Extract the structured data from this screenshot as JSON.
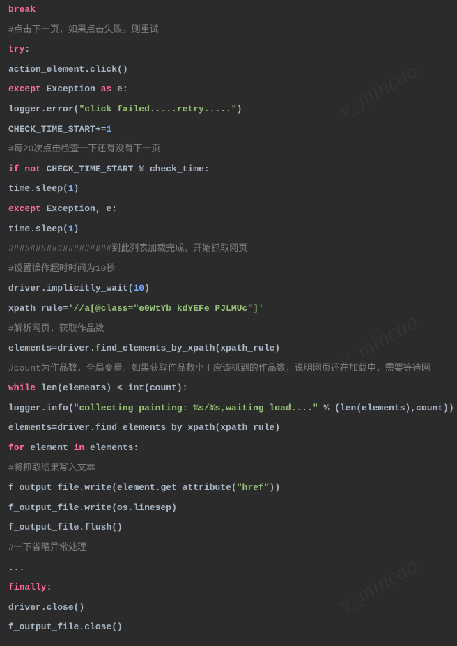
{
  "watermark": "v_mincao",
  "lines": [
    [
      {
        "t": "break",
        "c": "break"
      }
    ],
    [
      {
        "t": "#点击下一页，如果点击失败，则重试",
        "c": "comment"
      }
    ],
    [
      {
        "t": "try",
        "c": "try"
      },
      {
        "t": ":",
        "c": "punc"
      }
    ],
    [
      {
        "t": "action_element",
        "c": "ident"
      },
      {
        "t": ".",
        "c": "dot"
      },
      {
        "t": "click",
        "c": "ident"
      },
      {
        "t": "()",
        "c": "punc"
      }
    ],
    [
      {
        "t": "except",
        "c": "except"
      },
      {
        "t": " Exception ",
        "c": "ident"
      },
      {
        "t": "as",
        "c": "as"
      },
      {
        "t": " e:",
        "c": "ident"
      }
    ],
    [
      {
        "t": "logger",
        "c": "ident"
      },
      {
        "t": ".",
        "c": "dot"
      },
      {
        "t": "error",
        "c": "ident"
      },
      {
        "t": "(",
        "c": "punc"
      },
      {
        "t": "\"click failed.....retry.....\"",
        "c": "str2"
      },
      {
        "t": ")",
        "c": "punc"
      }
    ],
    [
      {
        "t": "CHECK_TIME_START",
        "c": "ident"
      },
      {
        "t": "+=",
        "c": "op"
      },
      {
        "t": "1",
        "c": "num2"
      }
    ],
    [
      {
        "t": "#每20次点击检查一下还有没有下一页",
        "c": "comment"
      }
    ],
    [
      {
        "t": "if",
        "c": "if"
      },
      {
        "t": " ",
        "c": "ident"
      },
      {
        "t": "not",
        "c": "not"
      },
      {
        "t": " CHECK_TIME_START % check_time:",
        "c": "ident"
      }
    ],
    [
      {
        "t": "time",
        "c": "ident"
      },
      {
        "t": ".",
        "c": "dot"
      },
      {
        "t": "sleep",
        "c": "ident"
      },
      {
        "t": "(",
        "c": "punc"
      },
      {
        "t": "1",
        "c": "num2"
      },
      {
        "t": ")",
        "c": "punc"
      }
    ],
    [
      {
        "t": "except",
        "c": "except"
      },
      {
        "t": " Exception, e:",
        "c": "ident"
      }
    ],
    [
      {
        "t": "time",
        "c": "ident"
      },
      {
        "t": ".",
        "c": "dot"
      },
      {
        "t": "sleep",
        "c": "ident"
      },
      {
        "t": "(",
        "c": "punc"
      },
      {
        "t": "1",
        "c": "num2"
      },
      {
        "t": ")",
        "c": "punc"
      }
    ],
    [
      {
        "t": "###################到此列表加载完成，开始抓取网页",
        "c": "comment"
      }
    ],
    [
      {
        "t": "#设置操作超时时间为10秒",
        "c": "comment"
      }
    ],
    [
      {
        "t": "driver",
        "c": "ident"
      },
      {
        "t": ".",
        "c": "dot"
      },
      {
        "t": "implicitly_wait",
        "c": "ident"
      },
      {
        "t": "(",
        "c": "punc"
      },
      {
        "t": "10",
        "c": "num2"
      },
      {
        "t": ")",
        "c": "punc"
      }
    ],
    [
      {
        "t": "xpath_rule",
        "c": "ident"
      },
      {
        "t": "=",
        "c": "op"
      },
      {
        "t": "'//a[@class=\"e0WtYb kdYEFe PJLMUc\"]'",
        "c": "str2"
      }
    ],
    [
      {
        "t": "#解析网页，获取作品数",
        "c": "comment"
      }
    ],
    [
      {
        "t": "elements=driver",
        "c": "ident"
      },
      {
        "t": ".",
        "c": "dot"
      },
      {
        "t": "find_elements_by_xpath",
        "c": "ident"
      },
      {
        "t": "(xpath_rule)",
        "c": "ident"
      }
    ],
    [
      {
        "t": "#count为作品数，全局变量，如果获取作品数小于应该抓到的作品数，说明网页还在加载中，需要等待网",
        "c": "comment"
      }
    ],
    [
      {
        "t": "while",
        "c": "while"
      },
      {
        "t": " len(elements) < int(count):",
        "c": "ident"
      }
    ],
    [
      {
        "t": "logger",
        "c": "ident"
      },
      {
        "t": ".",
        "c": "dot"
      },
      {
        "t": "info",
        "c": "ident"
      },
      {
        "t": "(",
        "c": "punc"
      },
      {
        "t": "\"collecting painting: %s/%s,waiting load....\"",
        "c": "str2"
      },
      {
        "t": " % (len(elements),count))",
        "c": "ident"
      }
    ],
    [
      {
        "t": "elements=driver",
        "c": "ident"
      },
      {
        "t": ".",
        "c": "dot"
      },
      {
        "t": "find_elements_by_xpath",
        "c": "ident"
      },
      {
        "t": "(xpath_rule)",
        "c": "ident"
      }
    ],
    [
      {
        "t": "for",
        "c": "for"
      },
      {
        "t": " element ",
        "c": "ident"
      },
      {
        "t": "in",
        "c": "in"
      },
      {
        "t": " elements:",
        "c": "ident"
      }
    ],
    [
      {
        "t": "#将抓取结果写入文本",
        "c": "comment"
      }
    ],
    [
      {
        "t": "f_output_file",
        "c": "ident"
      },
      {
        "t": ".",
        "c": "dot"
      },
      {
        "t": "write",
        "c": "ident"
      },
      {
        "t": "(element",
        "c": "ident"
      },
      {
        "t": ".",
        "c": "dot"
      },
      {
        "t": "get_attribute",
        "c": "ident"
      },
      {
        "t": "(",
        "c": "punc"
      },
      {
        "t": "\"href\"",
        "c": "str2"
      },
      {
        "t": "))",
        "c": "ident"
      }
    ],
    [
      {
        "t": "f_output_file",
        "c": "ident"
      },
      {
        "t": ".",
        "c": "dot"
      },
      {
        "t": "write",
        "c": "ident"
      },
      {
        "t": "(os",
        "c": "ident"
      },
      {
        "t": ".",
        "c": "dot"
      },
      {
        "t": "linesep)",
        "c": "ident"
      }
    ],
    [
      {
        "t": "f_output_file",
        "c": "ident"
      },
      {
        "t": ".",
        "c": "dot"
      },
      {
        "t": "flush",
        "c": "ident"
      },
      {
        "t": "()",
        "c": "punc"
      }
    ],
    [
      {
        "t": "#一下省略异常处理",
        "c": "comment"
      }
    ],
    [
      {
        "t": "...",
        "c": "ident"
      }
    ],
    [
      {
        "t": "finally",
        "c": "finally"
      },
      {
        "t": ":",
        "c": "punc"
      }
    ],
    [
      {
        "t": "driver",
        "c": "ident"
      },
      {
        "t": ".",
        "c": "dot"
      },
      {
        "t": "close",
        "c": "ident"
      },
      {
        "t": "()",
        "c": "punc"
      }
    ],
    [
      {
        "t": "f_output_file",
        "c": "ident"
      },
      {
        "t": ".",
        "c": "dot"
      },
      {
        "t": "close",
        "c": "ident"
      },
      {
        "t": "()",
        "c": "punc"
      }
    ]
  ]
}
